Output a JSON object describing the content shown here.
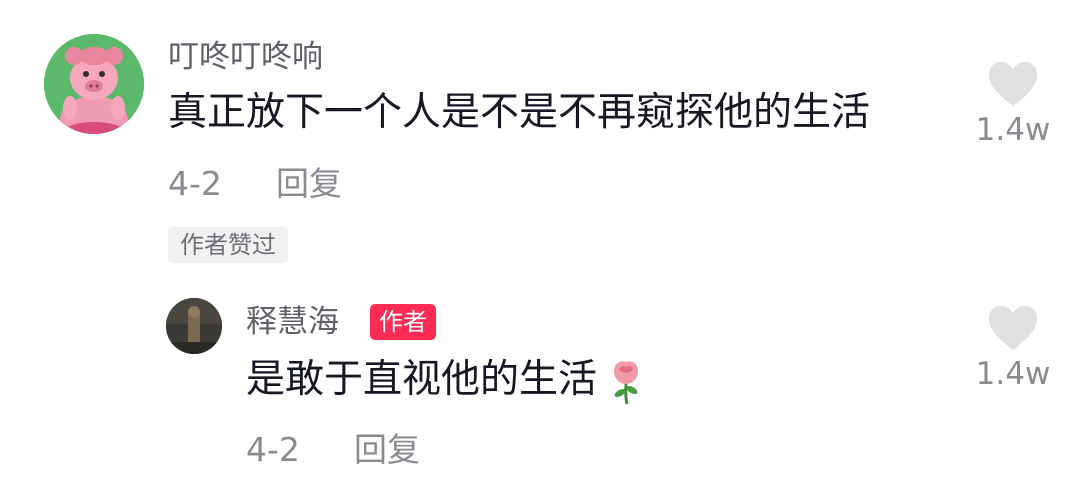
{
  "comment": {
    "username": "叮咚叮咚响",
    "text": "真正放下一个人是不是不再窥探他的生活",
    "date": "4-2",
    "reply_label": "回复",
    "liked_by_author": "作者赞过",
    "like_count": "1.4w",
    "avatar_icon": "cartoon-pig-avatar",
    "avatar_bg": "#5cb86a"
  },
  "reply": {
    "username": "释慧海",
    "author_badge": "作者",
    "text": "是敢于直视他的生活",
    "emoji_icon": "rose-icon",
    "date": "4-2",
    "reply_label": "回复",
    "like_count": "1.4w",
    "badge_color": "#fe2c55"
  }
}
